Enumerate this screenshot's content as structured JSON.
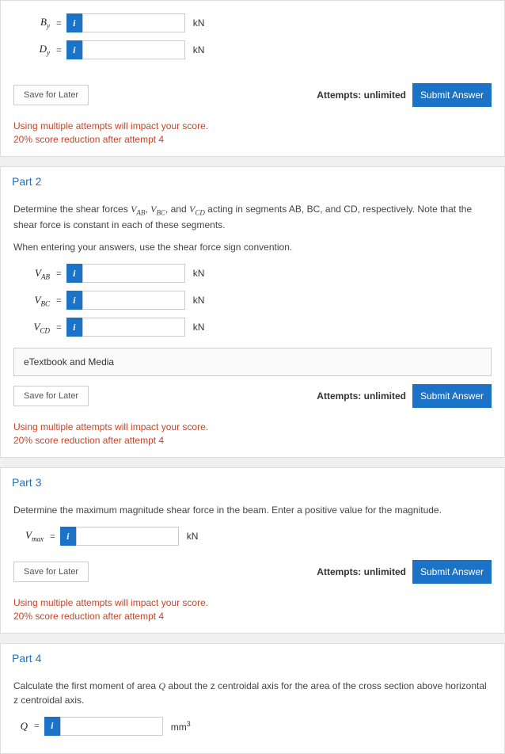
{
  "common": {
    "info_icon": "i",
    "save_label": "Save for Later",
    "attempts_label": "Attempts: unlimited",
    "submit_label": "Submit Answer",
    "warning_line1": "Using multiple attempts will impact your score.",
    "warning_line2": "20% score reduction after attempt 4"
  },
  "part1": {
    "inputs": [
      {
        "var": "B",
        "sub": "y",
        "unit": "kN",
        "value": ""
      },
      {
        "var": "D",
        "sub": "y",
        "unit": "kN",
        "value": ""
      }
    ]
  },
  "part2": {
    "title": "Part 2",
    "prompt_pre": "Determine the shear forces ",
    "v1": "V",
    "v1sub": "AB",
    "comma1": ", ",
    "v2": "V",
    "v2sub": "BC",
    "and1": ", and ",
    "v3": "V",
    "v3sub": "CD",
    "prompt_post": " acting in segments AB, BC, and CD, respectively.  Note that the shear force is constant in each of these segments.",
    "subprompt": "When entering your answers, use the shear force sign convention.",
    "inputs": [
      {
        "var": "V",
        "sub": "AB",
        "unit": "kN",
        "value": ""
      },
      {
        "var": "V",
        "sub": "BC",
        "unit": "kN",
        "value": ""
      },
      {
        "var": "V",
        "sub": "CD",
        "unit": "kN",
        "value": ""
      }
    ],
    "etextbook": "eTextbook and Media"
  },
  "part3": {
    "title": "Part 3",
    "prompt": "Determine the maximum magnitude shear force in the beam.  Enter a positive value for the magnitude.",
    "input": {
      "var": "V",
      "sub": "max",
      "unit": "kN",
      "value": ""
    }
  },
  "part4": {
    "title": "Part 4",
    "prompt_pre": "Calculate the first moment of area ",
    "qvar": "Q",
    "prompt_post": " about the z centroidal axis for the area of the cross section above horizontal z centroidal axis.",
    "input": {
      "var": "Q",
      "sub": "",
      "unit_base": "mm",
      "unit_sup": "3",
      "value": ""
    }
  }
}
